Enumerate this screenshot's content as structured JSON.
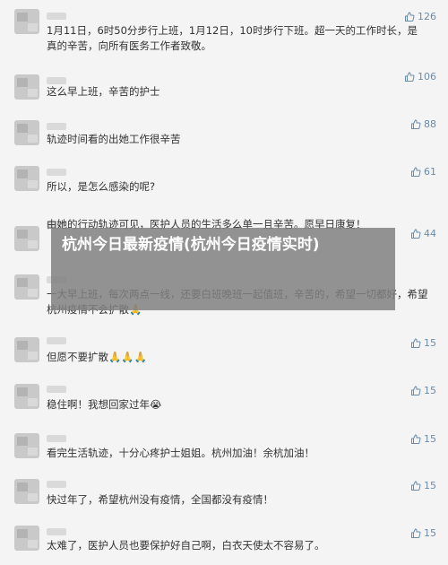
{
  "comments": [
    {
      "text": "1月11日，6时50分步行上班，1月12日，10时步行下班。超一天的工作时长，是真的辛苦，向所有医务工作者致敬。",
      "likes": "126"
    },
    {
      "text": "这么早上班，辛苦的护士",
      "likes": "106"
    },
    {
      "text": "轨迹时间看的出她工作很辛苦",
      "likes": "88"
    },
    {
      "text": "所以，是怎么感染的呢?",
      "likes": "61"
    },
    {
      "text": "由她的行动轨迹可见，医护人员的生活多么单一且辛苦。愿早日康复！",
      "likes": "44"
    },
    {
      "text": "一大早上班，每次两点一线，还要白班晚班一起值班，辛苦的，希望一切都好，希望杭州疫情不会扩散🙏",
      "likes": ""
    },
    {
      "text": "但愿不要扩散🙏🙏🙏",
      "likes": "15"
    },
    {
      "text": "稳住啊！我想回家过年😭",
      "likes": "15"
    },
    {
      "text": "看完生活轨迹，十分心疼护士姐姐。杭州加油！余杭加油！",
      "likes": "15"
    },
    {
      "text": "快过年了，希望杭州没有疫情，全国都没有疫情！",
      "likes": "15"
    },
    {
      "text": "太难了，医护人员也要保护好自己啊，白衣天使太不容易了。",
      "likes": "15"
    }
  ],
  "overlay": {
    "title": "杭州今日最新疫情(杭州今日疫情实时)"
  },
  "icons": {
    "like": "thumbs-up-icon"
  },
  "colors": {
    "background": "#f4f4f4",
    "text": "#333333",
    "like": "#6c8ba8",
    "overlay": "#808080"
  }
}
